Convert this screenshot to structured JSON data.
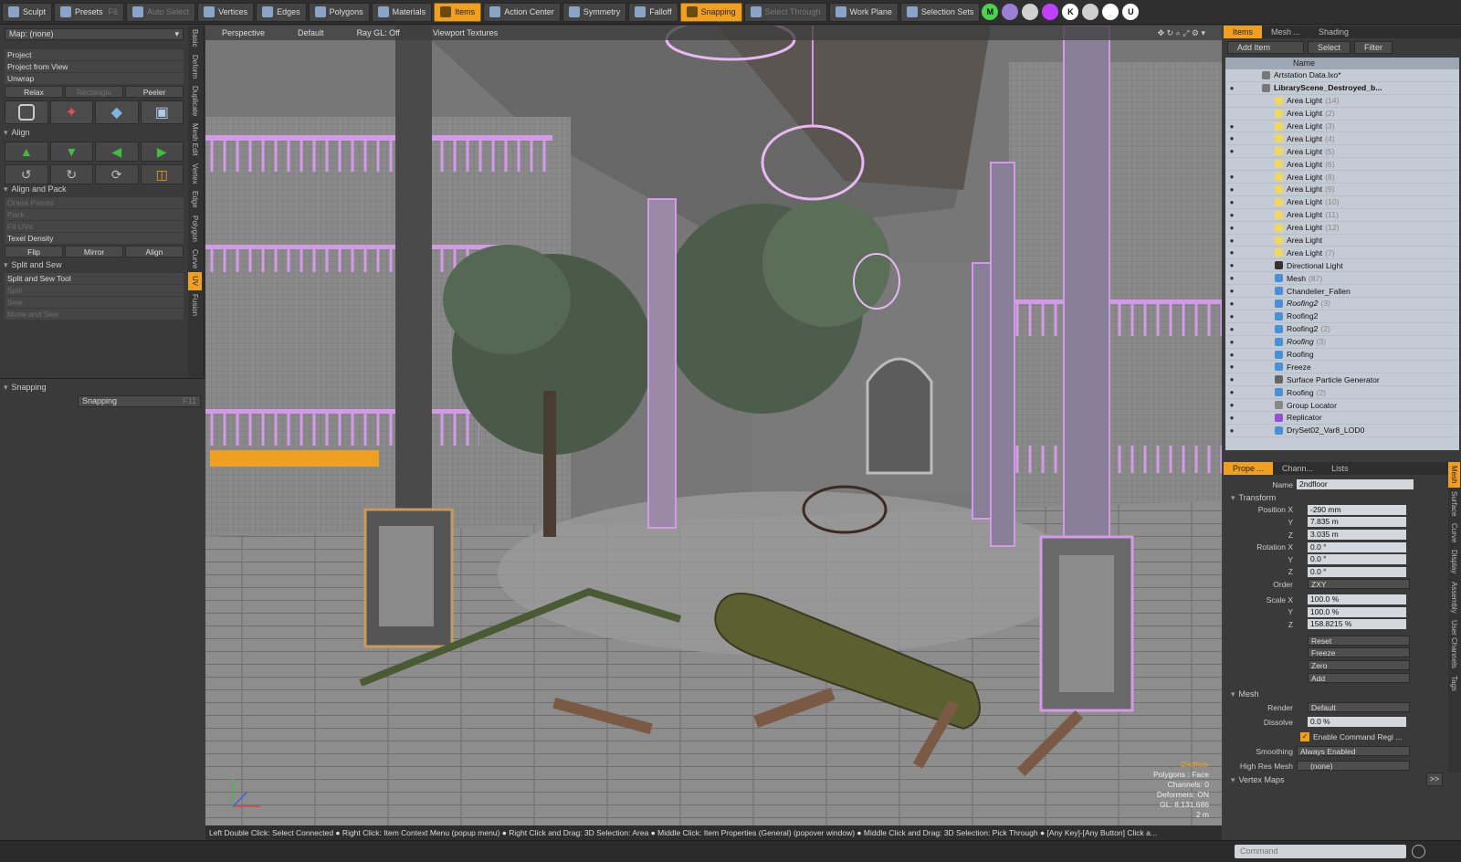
{
  "toolbar": {
    "items": [
      {
        "label": "Sculpt",
        "icon": "sculpt-icon",
        "state": "normal"
      },
      {
        "label": "Presets",
        "icon": "presets-icon",
        "state": "normal",
        "shortcut": "F6"
      },
      {
        "label": "Auto Select",
        "icon": "cube-icon",
        "state": "dim"
      },
      {
        "label": "Vertices",
        "icon": "vertices-icon",
        "state": "normal"
      },
      {
        "label": "Edges",
        "icon": "edges-icon",
        "state": "normal"
      },
      {
        "label": "Polygons",
        "icon": "polygons-icon",
        "state": "normal"
      },
      {
        "label": "Materials",
        "icon": "materials-icon",
        "state": "normal"
      },
      {
        "label": "Items",
        "icon": "items-icon",
        "state": "on"
      },
      {
        "label": "Action Center",
        "icon": "action-center-icon",
        "state": "normal"
      },
      {
        "label": "Symmetry",
        "icon": "symmetry-icon",
        "state": "normal"
      },
      {
        "label": "Falloff",
        "icon": "falloff-icon",
        "state": "normal"
      },
      {
        "label": "Snapping",
        "icon": "snapping-icon",
        "state": "on"
      },
      {
        "label": "Select Through",
        "icon": "select-through-icon",
        "state": "dim"
      },
      {
        "label": "Work Plane",
        "icon": "work-plane-icon",
        "state": "normal"
      },
      {
        "label": "Selection Sets",
        "icon": "selection-sets-icon",
        "state": "normal"
      }
    ],
    "circle_buttons": [
      {
        "glyph": "M",
        "color": "#4cd24c"
      },
      {
        "glyph": "",
        "color": "#9b7fd4"
      },
      {
        "glyph": "",
        "color": "#d0d0d0"
      },
      {
        "glyph": "",
        "color": "#c040ff"
      },
      {
        "glyph": "K",
        "color": "#ffffff"
      },
      {
        "glyph": "",
        "color": "#cfcfcf"
      },
      {
        "glyph": "",
        "color": "#ffffff"
      },
      {
        "glyph": "U",
        "color": "#ffffff"
      }
    ]
  },
  "left_panel": {
    "map_select": "Map: (none)",
    "unwrap_rows": [
      "Project",
      "Project from View",
      "Unwrap"
    ],
    "relax_row": [
      {
        "label": "Relax",
        "dim": false
      },
      {
        "label": "Rectangle",
        "dim": true
      },
      {
        "label": "Peeler",
        "dim": false
      }
    ],
    "align_header": "Align",
    "align_pack_header": "Align and Pack",
    "align_pack_rows": [
      {
        "label": "Orient Pieces",
        "dim": true
      },
      {
        "label": "Pack...",
        "dim": true
      },
      {
        "label": "Fit UVs",
        "dim": true
      },
      {
        "label": "Texel Density",
        "dim": false
      }
    ],
    "flip_row": [
      {
        "label": "Flip",
        "dim": false
      },
      {
        "label": "Mirror",
        "dim": false
      },
      {
        "label": "Align",
        "dim": false
      }
    ],
    "split_sew_header": "Split and Sew",
    "split_sew_rows": [
      {
        "label": "Split and Sew Tool",
        "dim": false
      },
      {
        "label": "Split",
        "dim": true
      },
      {
        "label": "Sew",
        "dim": true
      },
      {
        "label": "Move and Sew",
        "dim": true
      }
    ],
    "more_button": ">>",
    "snapping_header": "Snapping",
    "snapping_button": "Snapping",
    "snapping_shortcut": "F11"
  },
  "vertical_tabs": [
    "Basic",
    "Deform",
    "Duplicate",
    "Mesh Edit",
    "Vertex",
    "Edge",
    "Polygon",
    "Curve",
    "UV",
    "Fusion"
  ],
  "vertical_tab_active": "UV",
  "viewport": {
    "header": [
      "Perspective",
      "Default",
      "Ray GL: Off",
      "Viewport Textures"
    ],
    "info": [
      "2ndfloor",
      "Polygons : Face",
      "Channels: 0",
      "Deformers: ON",
      "GL: 8,131,686",
      "2 m"
    ]
  },
  "statusbar": "Left Double Click: Select Connected ● Right Click: Item Context Menu (popup menu) ● Right Click and Drag: 3D Selection: Area ● Middle Click: Item Properties (General) (popover window) ● Middle Click and Drag: 3D Selection: Pick Through ● [Any Key]-[Any Button] Click a...",
  "command_placeholder": "Command",
  "items_panel": {
    "tabs": [
      "Items",
      "Mesh ...",
      "Shading"
    ],
    "active_tab": "Items",
    "add_item": "Add Item",
    "select": "Select",
    "filter": "Filter",
    "column": "Name",
    "rows": [
      {
        "name": "Artstation Data.lxo*",
        "count": "",
        "indent": 0,
        "eye": false,
        "italic": false,
        "bold": false,
        "icon_color": "#777777"
      },
      {
        "name": "LibraryScene_Destroyed_b...",
        "count": "",
        "indent": 0,
        "eye": true,
        "italic": false,
        "bold": true,
        "icon_color": "#777777"
      },
      {
        "name": "Area Light",
        "count": "(14)",
        "indent": 1,
        "eye": false,
        "italic": false,
        "bold": false,
        "icon_color": "#f0d860"
      },
      {
        "name": "Area Light",
        "count": "(2)",
        "indent": 1,
        "eye": false,
        "italic": false,
        "bold": false,
        "icon_color": "#f0d860"
      },
      {
        "name": "Area Light",
        "count": "(3)",
        "indent": 1,
        "eye": true,
        "italic": false,
        "bold": false,
        "icon_color": "#f0d860"
      },
      {
        "name": "Area Light",
        "count": "(4)",
        "indent": 1,
        "eye": true,
        "italic": false,
        "bold": false,
        "icon_color": "#f0d860"
      },
      {
        "name": "Area Light",
        "count": "(5)",
        "indent": 1,
        "eye": true,
        "italic": false,
        "bold": false,
        "icon_color": "#f0d860"
      },
      {
        "name": "Area Light",
        "count": "(6)",
        "indent": 1,
        "eye": false,
        "italic": false,
        "bold": false,
        "icon_color": "#f0d860"
      },
      {
        "name": "Area Light",
        "count": "(8)",
        "indent": 1,
        "eye": true,
        "italic": false,
        "bold": false,
        "icon_color": "#f0d860"
      },
      {
        "name": "Area Light",
        "count": "(9)",
        "indent": 1,
        "eye": true,
        "italic": false,
        "bold": false,
        "icon_color": "#f0d860"
      },
      {
        "name": "Area Light",
        "count": "(10)",
        "indent": 1,
        "eye": true,
        "italic": false,
        "bold": false,
        "icon_color": "#f0d860"
      },
      {
        "name": "Area Light",
        "count": "(11)",
        "indent": 1,
        "eye": true,
        "italic": false,
        "bold": false,
        "icon_color": "#f0d860"
      },
      {
        "name": "Area Light",
        "count": "(12)",
        "indent": 1,
        "eye": true,
        "italic": false,
        "bold": false,
        "icon_color": "#f0d860"
      },
      {
        "name": "Area Light",
        "count": "",
        "indent": 1,
        "eye": true,
        "italic": false,
        "bold": false,
        "icon_color": "#f0d860"
      },
      {
        "name": "Area Light",
        "count": "(7)",
        "indent": 1,
        "eye": true,
        "italic": false,
        "bold": false,
        "icon_color": "#f0d860"
      },
      {
        "name": "Directional Light",
        "count": "",
        "indent": 1,
        "eye": true,
        "italic": false,
        "bold": false,
        "icon_color": "#333333"
      },
      {
        "name": "Mesh",
        "count": "(87)",
        "indent": 1,
        "eye": true,
        "italic": false,
        "bold": false,
        "icon_color": "#4a90d9"
      },
      {
        "name": "Chandelier_Fallen",
        "count": "",
        "indent": 1,
        "eye": true,
        "italic": false,
        "bold": false,
        "icon_color": "#4a90d9"
      },
      {
        "name": "Roofing2",
        "count": "(3)",
        "indent": 1,
        "eye": true,
        "italic": true,
        "bold": false,
        "icon_color": "#4a90d9"
      },
      {
        "name": "Roofing2",
        "count": "",
        "indent": 1,
        "eye": true,
        "italic": false,
        "bold": false,
        "icon_color": "#4a90d9"
      },
      {
        "name": "Roofing2",
        "count": "(2)",
        "indent": 1,
        "eye": true,
        "italic": false,
        "bold": false,
        "icon_color": "#4a90d9"
      },
      {
        "name": "Roofing",
        "count": "(3)",
        "indent": 1,
        "eye": true,
        "italic": true,
        "bold": false,
        "icon_color": "#4a90d9"
      },
      {
        "name": "Roofing",
        "count": "",
        "indent": 1,
        "eye": true,
        "italic": false,
        "bold": false,
        "icon_color": "#4a90d9"
      },
      {
        "name": "Freeze",
        "count": "",
        "indent": 1,
        "eye": true,
        "italic": false,
        "bold": false,
        "icon_color": "#4a90d9"
      },
      {
        "name": "Surface Particle Generator",
        "count": "",
        "indent": 1,
        "eye": true,
        "italic": false,
        "bold": false,
        "icon_color": "#666666"
      },
      {
        "name": "Roofing",
        "count": "(2)",
        "indent": 1,
        "eye": true,
        "italic": false,
        "bold": false,
        "icon_color": "#4a90d9"
      },
      {
        "name": "Group Locator",
        "count": "",
        "indent": 1,
        "eye": true,
        "italic": false,
        "bold": false,
        "icon_color": "#888888"
      },
      {
        "name": "Replicator",
        "count": "",
        "indent": 1,
        "eye": true,
        "italic": false,
        "bold": false,
        "icon_color": "#9a4fd0"
      },
      {
        "name": "DrySet02_Var8_LOD0",
        "count": "",
        "indent": 1,
        "eye": true,
        "italic": false,
        "bold": false,
        "icon_color": "#4a90d9"
      }
    ]
  },
  "properties": {
    "tabs": [
      "Prope ...",
      "Chann...",
      "Lists"
    ],
    "active_tab": "Prope ...",
    "side_tabs": [
      "Mesh",
      "Surface",
      "Curve",
      "Display",
      "Assembly",
      "User Channels",
      "Tags"
    ],
    "side_active": "Mesh",
    "name_label": "Name",
    "name_value": "2ndfloor",
    "transform_header": "Transform",
    "transform_rows": [
      {
        "label": "Position X",
        "value": "-290 mm"
      },
      {
        "label": "Y",
        "value": "7.835 m"
      },
      {
        "label": "Z",
        "value": "3.035 m"
      },
      {
        "label": "Rotation X",
        "value": "0.0 °"
      },
      {
        "label": "Y",
        "value": "0.0 °"
      },
      {
        "label": "Z",
        "value": "0.0 °"
      }
    ],
    "order_label": "Order",
    "order_value": "ZXY",
    "scale_rows": [
      {
        "label": "Scale X",
        "value": "100.0 %"
      },
      {
        "label": "Y",
        "value": "100.0 %"
      },
      {
        "label": "Z",
        "value": "158.8215 %"
      }
    ],
    "actions": [
      "Reset",
      "Freeze",
      "Zero",
      "Add"
    ],
    "mesh_header": "Mesh",
    "render_label": "Render",
    "render_value": "Default",
    "dissolve_label": "Dissolve",
    "dissolve_value": "0.0 %",
    "enable_command": "Enable Command Regi ...",
    "smoothing_label": "Smoothing",
    "smoothing_value": "Always Enabled",
    "highres_label": "High Res Mesh",
    "highres_value": "(none)",
    "vertex_maps_header": "Vertex Maps",
    "more_button": ">>"
  },
  "colors": {
    "accent": "#f0a020",
    "selection_pink": "#d39ae8"
  }
}
